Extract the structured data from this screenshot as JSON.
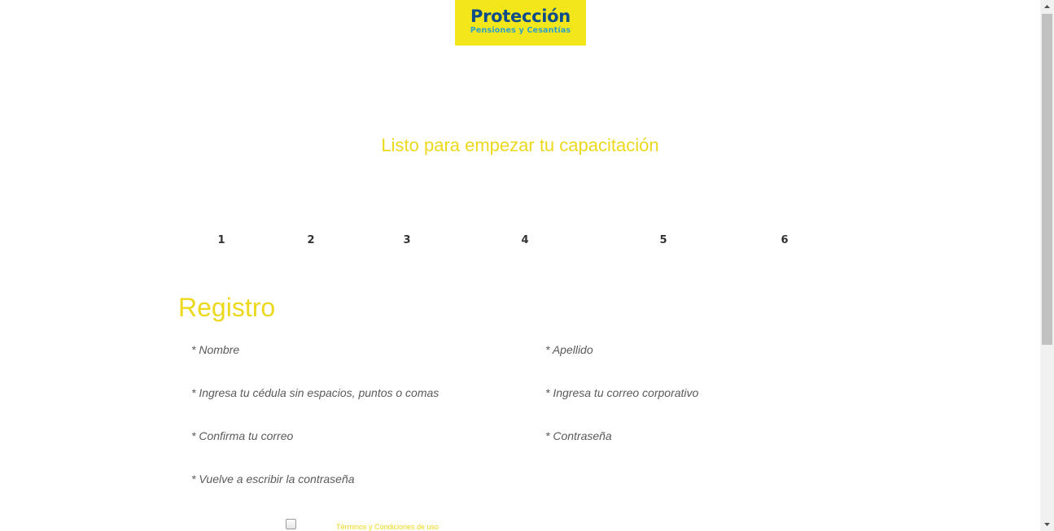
{
  "logo": {
    "name": "Protección",
    "tagline": "Pensiones y Cesantías"
  },
  "hero": {
    "title": "Listo para empezar tu capacitación"
  },
  "steps": [
    "1",
    "2",
    "3",
    "4",
    "5",
    "6"
  ],
  "form": {
    "title": "Registro",
    "fields": {
      "nombre": {
        "placeholder": "* Nombre",
        "value": ""
      },
      "apellido": {
        "placeholder": "* Apellido",
        "value": ""
      },
      "cedula": {
        "placeholder": "* Ingresa tu cédula sin espacios, puntos o comas",
        "value": ""
      },
      "correo": {
        "placeholder": "* Ingresa tu correo corporativo",
        "value": ""
      },
      "confirma_correo": {
        "placeholder": "* Confirma tu correo",
        "value": ""
      },
      "contrasena": {
        "placeholder": "* Contraseña",
        "value": ""
      },
      "repite_contrasena": {
        "placeholder": "* Vuelve a escribir la contraseña",
        "value": ""
      }
    },
    "terms": {
      "checked": false,
      "label": "Términos y Condiciones de uso"
    }
  },
  "colors": {
    "brand_yellow": "#f3e71b",
    "heading_yellow": "#ecd81c",
    "logo_blue": "#0f4c8a",
    "logo_cyan": "#2fa0c8"
  }
}
